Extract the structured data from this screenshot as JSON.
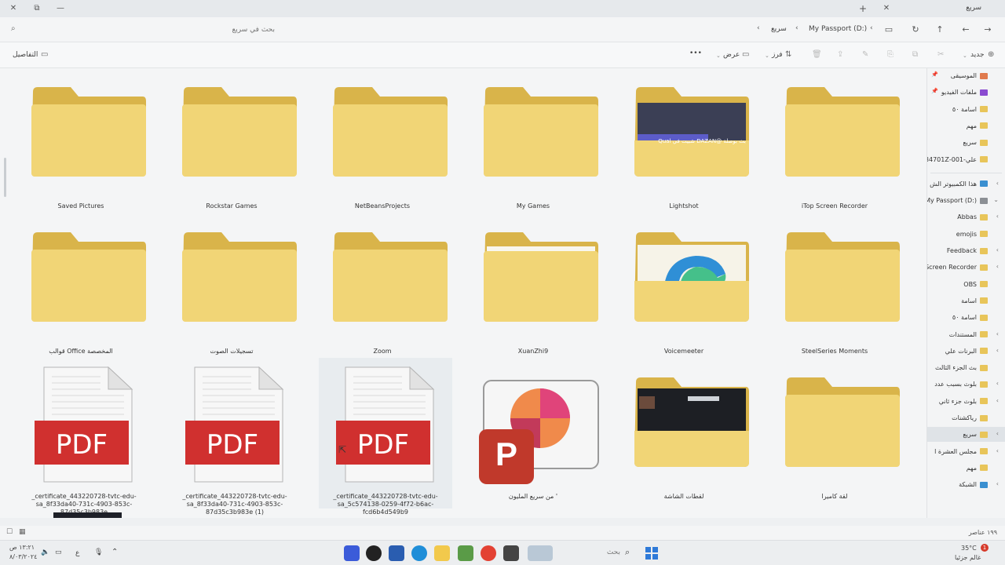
{
  "window": {
    "tab_title": "سريع",
    "close_glyph": "✕",
    "restore_glyph": "⧉",
    "minimize_glyph": "—",
    "tab_add_glyph": "+",
    "tab_close_glyph": "✕"
  },
  "address": {
    "search_placeholder": "بحث في سريع",
    "breadcrumbs": [
      "My Passport (D:)",
      "سريع"
    ]
  },
  "toolbar": {
    "new_label": "جديد",
    "sort_label": "فرز",
    "view_label": "عرض",
    "more_glyph": "•••",
    "details_label": "التفاصيل"
  },
  "sidebar": {
    "quick": [
      "الموسيقى",
      "ملفات الفيديو",
      "اسامة ٥٠",
      "مهم",
      "سريع",
      "علي-001-84701Z"
    ],
    "pc_label": "هذا الكمبيوتر الش",
    "drive_label": "My Passport (D:)",
    "drive_items": [
      "Abbas",
      "emojis",
      "Feedback",
      "Screen Recorder",
      "OBS",
      "اسامة",
      "اسامة ٥٠",
      "المستندات",
      "البرنات علي",
      "بث الجزء الثالث",
      "بلوث بسبب عدد",
      "بلوث جزء ثاني",
      "رياكشنات",
      "سريع",
      "مجلس العشرة ا",
      "مهم"
    ],
    "network_label": "الشبكة"
  },
  "grid": {
    "row1": [
      "iTop Screen Recorder",
      "Lightshot",
      "My Games",
      "NetBeansProjects",
      "Rockstar Games",
      "Saved Pictures"
    ],
    "row2": [
      "SteelSeries Moments",
      "Voicemeeter",
      "XuanZhi9",
      "Zoom",
      "تسجيلات الصوت",
      "قوالب Office المخصصة"
    ],
    "row3": [
      "لقة كاميرا",
      "لقطات الشاشة",
      "من سريع المليون '",
      "_certificate_443220728-tvtc-edu-sa_5c574138-0259-4f72-b6ac-fcd6b4d549b9",
      "_certificate_443220728-tvtc-edu-sa_8f33da40-731c-4903-853c-87d35c3b983e (1)",
      "_certificate_443220728-tvtc-edu-sa_8f33da40-731c-4903-853c-87d35c3b983e"
    ],
    "lightshot_thumb_text": "بث بوصلة @DAZAN شبيت في Qual",
    "pdf_label": "PDF",
    "ppt_letter": "P"
  },
  "status": {
    "item_count": "١٩٩ عناصر"
  },
  "taskbar": {
    "weather_temp": "35°C",
    "weather_desc": "غالم جزئيا",
    "search_placeholder": "بحث",
    "clock_time": "١٣:٢١ ص",
    "clock_date": "٨/٠٣/٢٠٢٤",
    "lang": "ع",
    "badge": "1"
  },
  "colors": {
    "folder": "#e9c75b",
    "folder_back": "#d9b44a",
    "pdf_red": "#d0302f",
    "ppt_red": "#c0392b"
  }
}
